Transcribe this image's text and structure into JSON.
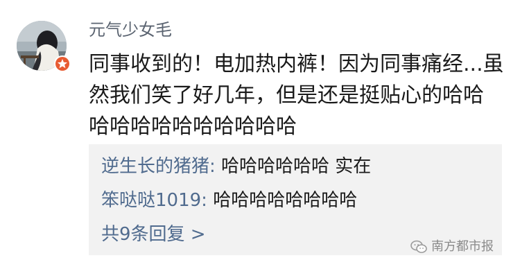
{
  "comment": {
    "username": "元气少女毛",
    "text_lines": [
      "同事收到的！电加热内裤！因为同事痛经...虽",
      "然我们笑了好几年，但是还是挺贴心的哈哈",
      "哈哈哈哈哈哈哈哈哈哈"
    ]
  },
  "replies": {
    "items": [
      {
        "author": "逆生长的猪猪:",
        "text": "哈哈哈哈哈哈 实在"
      },
      {
        "author": "笨哒哒1019:",
        "text": "哈哈哈哈哈哈哈哈"
      }
    ],
    "more_label": "共9条回复 >"
  },
  "watermark": {
    "text": "南方都市报",
    "icon": "wechat-icon"
  },
  "icons": {
    "avatar": "avatar-photo",
    "badge": "verified-badge-icon"
  },
  "colors": {
    "username": "#5b6471",
    "reply_author": "#506b8e",
    "reply_bg": "#f2f2f2",
    "badge": "#e85b32"
  }
}
